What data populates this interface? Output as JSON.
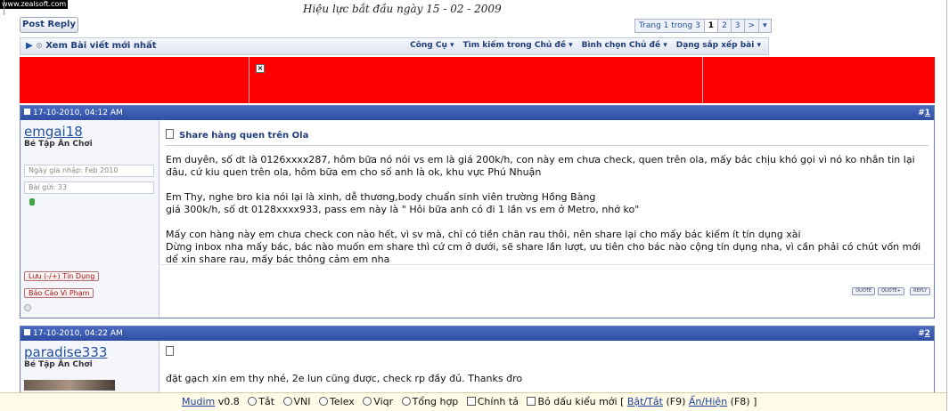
{
  "watermark": "www.zealsoft.com",
  "top_text": "Hiệu lực bắt đầu ngày 15 - 02 - 2009",
  "post_reply_label": "Post Reply",
  "pagenav": {
    "label": "Trang 1 trong 3",
    "pages": [
      "1",
      "2",
      "3"
    ],
    "next": ">",
    "menu": "▾"
  },
  "toolbar": {
    "left": "Xem Bài viết mới nhất",
    "items": [
      "Công Cụ ▾",
      "Tìm kiếm trong Chủ đề ▾",
      "Bình chọn Chủ đề ▾",
      "Dạng sắp xếp bài ▾"
    ]
  },
  "post1": {
    "date": "17-10-2010, 04:12 AM",
    "number": "1",
    "username": "emgai18",
    "usertitle": "Bé Tập Ăn Chơi",
    "join_date": "Ngày gia nhập: Feb 2010",
    "posts": "Bài gửi: 33",
    "rep_button": "Lưu (-/+) Tín Dụng",
    "report_button": "Báo Cáo Vi Phạm",
    "title": "Share hàng quen trên Ola",
    "paragraphs": [
      "Em duyên, số dt là 0126xxxx287, hôm bữa nó nói vs em là giá 200k/h, con này em chưa check, quen trên ola, mấy bác chịu khó gọi vì nó ko nhắn tin lại đâu, cứ kiu quen trên ola, hôm bữa em cho số anh là ok, khu vực Phú Nhuận",
      "Em Thy, nghe bro kia nói lại là xinh, dễ thương,body chuẩn sinh viên trường Hồng Bàng\ngiá 300k/h, số dt 0128xxxx933, pass em này là \" Hôi bữa anh có đi 1 lần vs em ở Metro, nhớ ko\"",
      "Mấy con hàng này em chưa check con nào hết, vì sv mà, chỉ có tiền chăn rau thôi, nên share lại cho mấy bác kiếm ít tín dụng xài\nDừng inbox nha mấy bác, bác nào muốn em share thì cứ cm ở dưới, sẽ share lần lượt, ưu tiên cho bác nào cộng tín dụng nha, vì cần phải có chút vốn mới dể xin share rau, mấy bác thông cảm em nha"
    ],
    "buttons": [
      "QUOTE",
      "QUOTE+",
      "REPLY"
    ]
  },
  "post2": {
    "date": "17-10-2010, 04:22 AM",
    "number": "2",
    "username": "paradise333",
    "usertitle": "Bé Tập Ăn Chơi",
    "body": "đặt gạch xin em thy nhé, 2e lun cũng được, check rp đầy đủ. Thanks đro"
  },
  "mudim": {
    "name": "Mudim",
    "version": "v0.8",
    "options": [
      "Tắt",
      "VNI",
      "Telex",
      "Viqr",
      "Tổng hợp"
    ],
    "checks": [
      "Chính tả",
      "Bỏ dấu kiểu mới"
    ],
    "open_bracket": "[",
    "toggle": "Bật/Tắt",
    "toggle_key": "(F9)",
    "show": "Ẩn/Hiện",
    "show_key": "(F8)",
    "close_bracket": "]"
  }
}
